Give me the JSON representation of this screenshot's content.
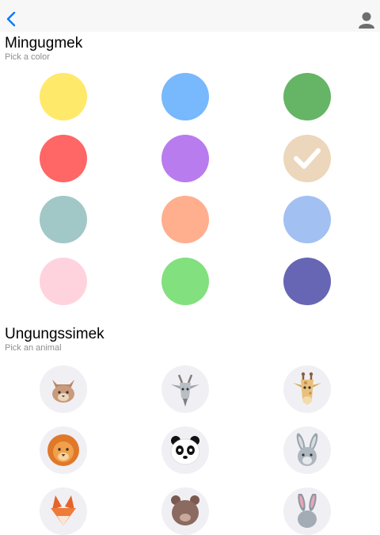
{
  "colors_section": {
    "title": "Mingugmek",
    "subtitle": "Pick a color",
    "swatches": [
      {
        "color": "#ffe96a",
        "selected": false
      },
      {
        "color": "#78b8fc",
        "selected": false
      },
      {
        "color": "#66b466",
        "selected": false
      },
      {
        "color": "#ff6666",
        "selected": false
      },
      {
        "color": "#b87cee",
        "selected": false
      },
      {
        "color": "#ecd7bc",
        "selected": true
      },
      {
        "color": "#a2c7c7",
        "selected": false
      },
      {
        "color": "#ffae8e",
        "selected": false
      },
      {
        "color": "#a2c0f2",
        "selected": false
      },
      {
        "color": "#ffd3dd",
        "selected": false
      },
      {
        "color": "#82e07e",
        "selected": false
      },
      {
        "color": "#6666b4",
        "selected": false
      }
    ]
  },
  "animals_section": {
    "title": "Ungungssimek",
    "subtitle": "Pick an animal",
    "animals": [
      "cat-icon",
      "goat-icon",
      "giraffe-icon",
      "lion-icon",
      "panda-icon",
      "rabbit-icon",
      "fox-icon",
      "bear-icon",
      "bunny-icon"
    ]
  },
  "nav": {
    "back_icon": "chevron-left-icon",
    "profile_icon": "person-icon",
    "accent": "#007aff"
  }
}
